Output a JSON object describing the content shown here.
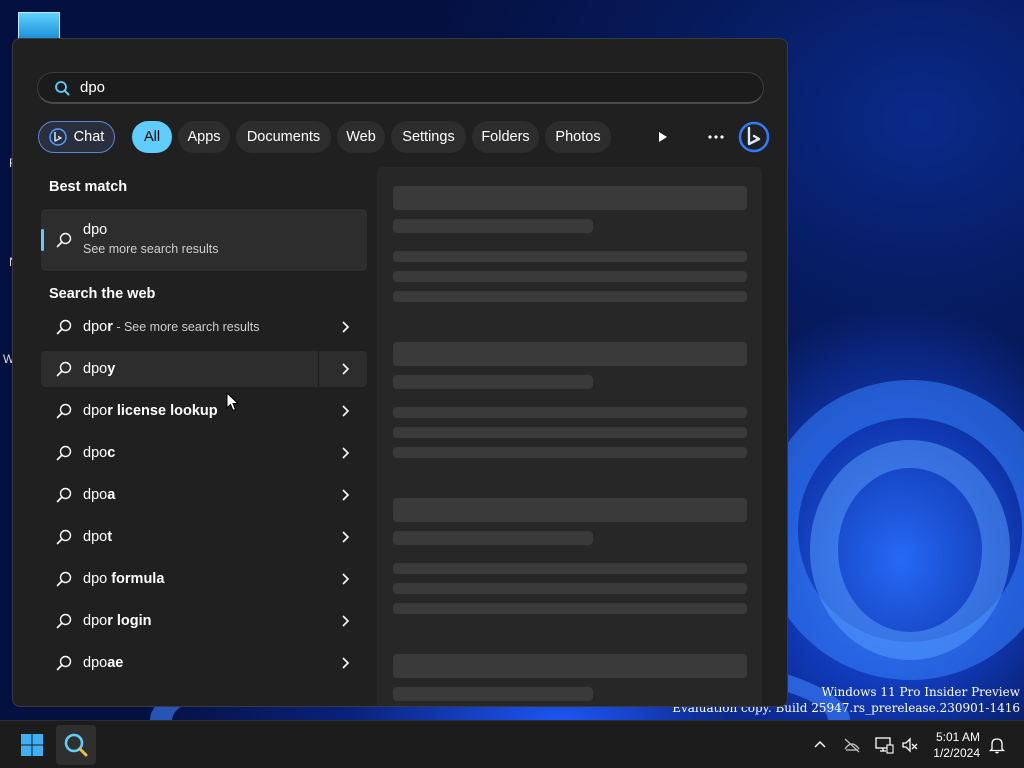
{
  "desktop": {
    "edge_letters": [
      "F",
      "N",
      "W"
    ],
    "watermark": {
      "line1": "Windows 11 Pro Insider Preview",
      "line2": "Evaluation copy. Build 25947.rs_prerelease.230901-1416"
    }
  },
  "search": {
    "query": "dpo",
    "filters": [
      {
        "label": "Chat"
      },
      {
        "label": "All"
      },
      {
        "label": "Apps"
      },
      {
        "label": "Documents"
      },
      {
        "label": "Web"
      },
      {
        "label": "Settings"
      },
      {
        "label": "Folders"
      },
      {
        "label": "Photos"
      }
    ],
    "active_filter": "All",
    "best_match": {
      "heading": "Best match",
      "title": "dpo",
      "subtitle": "See more search results"
    },
    "web": {
      "heading": "Search the web",
      "results": [
        {
          "typed": "dpo",
          "rest": "r",
          "suffix": " - See more search results"
        },
        {
          "typed": "dpo",
          "rest": "y",
          "suffix": ""
        },
        {
          "typed": "dpo",
          "rest": "r license lookup",
          "suffix": ""
        },
        {
          "typed": "dpo",
          "rest": "c",
          "suffix": ""
        },
        {
          "typed": "dpo",
          "rest": "a",
          "suffix": ""
        },
        {
          "typed": "dpo",
          "rest": "t",
          "suffix": ""
        },
        {
          "typed": "dpo",
          "rest": " formula",
          "suffix": ""
        },
        {
          "typed": "dpo",
          "rest": "r login",
          "suffix": ""
        },
        {
          "typed": "dpo",
          "rest": "ae",
          "suffix": ""
        }
      ]
    }
  },
  "taskbar": {
    "time": "5:01 AM",
    "date": "1/2/2024"
  },
  "colors": {
    "accent": "#60cdff",
    "panel": "#202020",
    "chip": "#2d2d2d"
  },
  "icons": [
    "search-icon",
    "bing-icon",
    "play-icon",
    "more-icon",
    "chevron-right-icon",
    "windows-start-icon",
    "chevron-up-icon",
    "network-icon",
    "display-icon",
    "volume-muted-icon",
    "notification-bell-icon"
  ]
}
